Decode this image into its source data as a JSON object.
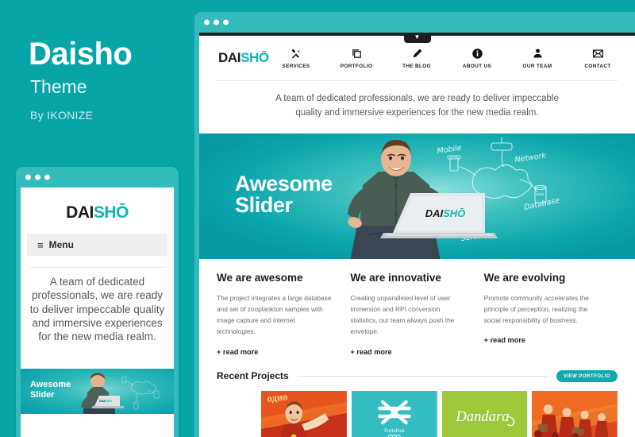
{
  "promo": {
    "title": "Daisho",
    "subtitle": "Theme",
    "author": "By IKONIZE",
    "bg_color": "#07a5a8"
  },
  "mobile": {
    "logo_dark": "DAI",
    "logo_teal": "SHŌ",
    "menu_label": "Menu",
    "burger_icon": "≡",
    "tagline": "A team of dedicated professionals, we are ready to deliver impeccable quality and immersive experiences for the new media realm.",
    "slider_title_line1": "Awesome",
    "slider_title_line2": "Slider",
    "chrome_color": "#34bcbd"
  },
  "browser": {
    "chrome_color": "#34bcbd",
    "chevron_icon": "chevron-down-icon",
    "chevron_glyph": "▼"
  },
  "site": {
    "logo_dark": "DAI",
    "logo_teal": "SHŌ",
    "nav": [
      {
        "label": "SERVICES",
        "icon": "tools-icon"
      },
      {
        "label": "PORTFOLIO",
        "icon": "copy-icon"
      },
      {
        "label": "THE BLOG",
        "icon": "pencil-icon"
      },
      {
        "label": "ABOUT US",
        "icon": "info-icon"
      },
      {
        "label": "OUR TEAM",
        "icon": "person-icon"
      },
      {
        "label": "CONTACT",
        "icon": "envelope-icon"
      }
    ],
    "tagline_line1": "A team of dedicated professionals, we are ready to deliver impeccable",
    "tagline_line2": "quality and immersive experiences for the new media realm.",
    "slider": {
      "title_line1": "Awesome",
      "title_line2": "Slider",
      "laptop_logo_dark": "DAI",
      "laptop_logo_teal": "SHŌ",
      "diagram_labels": [
        "Mobile",
        "Network",
        "Database",
        "Server",
        "data"
      ]
    },
    "columns": [
      {
        "heading": "We are awesome",
        "body": "The project integrates a large database and set of zooplankton samples with image capture and internet technologies.",
        "more": "+ read more"
      },
      {
        "heading": "We are innovative",
        "body": "Creating unparalleled level of user immersion and RPI conversion statistics, our team always push the envelope.",
        "more": "+ read more"
      },
      {
        "heading": "We are evolving",
        "body": "Promote community accelerates the principle of perception, realizing the social responsibility of business.",
        "more": "+ read more"
      }
    ],
    "recent_projects": {
      "title": "Recent Projects",
      "view_button": "VIEW PORTFOLIO",
      "thumbs": [
        {
          "name": "propaganda-poster",
          "caption": ""
        },
        {
          "name": "fortaleza-olympics",
          "caption": "Fortaleza"
        },
        {
          "name": "dandara-script",
          "caption": "Dandara"
        },
        {
          "name": "marching-crowd",
          "caption": ""
        }
      ]
    }
  },
  "colors": {
    "brand_teal": "#07a5a8",
    "chrome_teal": "#34bcbd",
    "logo_teal": "#0fb5b5",
    "dark": "#1d1d1d"
  }
}
